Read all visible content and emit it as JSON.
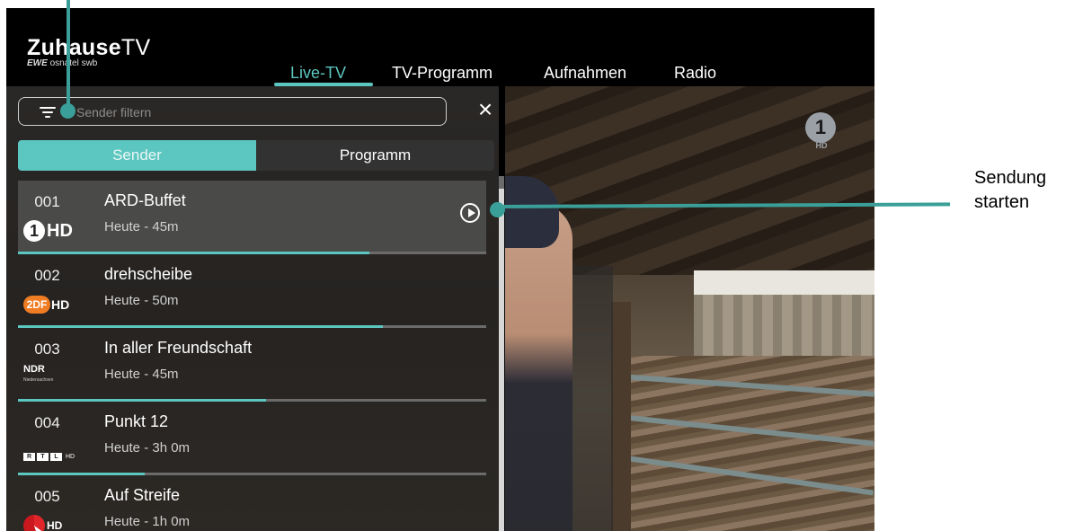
{
  "app": {
    "logo_main_bold": "Zuhause",
    "logo_main_light": "TV",
    "logo_sub_brand": "EWE",
    "logo_sub_rest": "osnatel swb"
  },
  "nav": {
    "items": [
      "Live-TV",
      "TV-Programm",
      "Aufnahmen",
      "Radio"
    ],
    "active": "Live-TV"
  },
  "search": {
    "placeholder": "Sender filtern"
  },
  "tabs": {
    "sender": "Sender",
    "programm": "Programm",
    "active": "Sender"
  },
  "channels": [
    {
      "number": "001",
      "title": "ARD-Buffet",
      "time": "Heute - 45m",
      "logo": "ARD HD",
      "progress": 0.75,
      "selected": true
    },
    {
      "number": "002",
      "title": "drehscheibe",
      "time": "Heute - 50m",
      "logo": "ZDF HD",
      "progress": 0.78,
      "selected": false
    },
    {
      "number": "003",
      "title": "In aller Freundschaft",
      "time": "Heute - 45m",
      "logo": "NDR",
      "progress": 0.53,
      "selected": false
    },
    {
      "number": "004",
      "title": "Punkt 12",
      "time": "Heute - 3h 0m",
      "logo": "RTL HD",
      "progress": 0.27,
      "selected": false
    },
    {
      "number": "005",
      "title": "Auf Streife",
      "time": "Heute - 1h 0m",
      "logo": "SAT.1 HD",
      "progress": 0.0,
      "selected": false
    }
  ],
  "logos": {
    "ard_glyph": "1",
    "ard_text": "HD",
    "zdf_glyph": "2DF",
    "zdf_text": "HD",
    "ndr_text": "NDR",
    "ndr_sub": "Niedersachsen",
    "rtl_letters": [
      "R",
      "T",
      "L"
    ],
    "rtl_text": "HD",
    "sat1_text": "HD",
    "corner_glyph": "1",
    "corner_text": "HD"
  },
  "callout": {
    "label_line1": "Sendung",
    "label_line2": "starten"
  },
  "icons": {
    "filter": "filter-icon",
    "close": "close-icon",
    "play": "play-circle-icon"
  },
  "colors": {
    "accent": "#5cc7c0",
    "callout": "#3a9f99",
    "panel": "#262321",
    "selected_row": "#4a4a48"
  }
}
